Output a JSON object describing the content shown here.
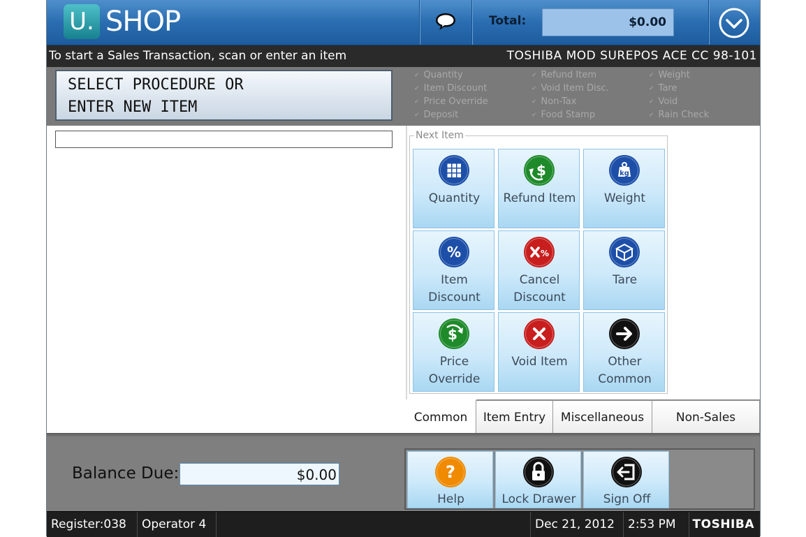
{
  "header": {
    "logo_mark": "U.",
    "logo_text": "SHOP",
    "total_label": "Total:",
    "total_value": "$0.00"
  },
  "status": {
    "message": "To start a Sales Transaction, scan or enter an item",
    "device": "TOSHIBA MOD SUREPOS ACE CC 98-101"
  },
  "prompt": {
    "line1": "SELECT PROCEDURE OR",
    "line2": "ENTER NEW ITEM"
  },
  "procedures": [
    [
      "Quantity",
      "Item Discount",
      "Price Override",
      "Deposit"
    ],
    [
      "Refund Item",
      "Void Item Disc.",
      "Non-Tax",
      "Food Stamp"
    ],
    [
      "Weight",
      "Tare",
      "Void",
      "Rain Check"
    ]
  ],
  "item_entry": {
    "value": ""
  },
  "next_item": {
    "legend": "Next Item",
    "buttons": [
      {
        "lines": [
          "Quantity"
        ],
        "icon": "grid-icon",
        "color": "#1d4fa8"
      },
      {
        "lines": [
          "Refund Item"
        ],
        "icon": "refund-dollar-icon",
        "color": "#1e8a2a"
      },
      {
        "lines": [
          "Weight"
        ],
        "icon": "weight-kg-icon",
        "color": "#1d4fa8"
      },
      {
        "lines": [
          "Item",
          "Discount"
        ],
        "icon": "percent-icon",
        "color": "#1d4fa8"
      },
      {
        "lines": [
          "Cancel",
          "Discount"
        ],
        "icon": "cancel-percent-icon",
        "color": "#c81e1e"
      },
      {
        "lines": [
          "Tare"
        ],
        "icon": "box-icon",
        "color": "#1d4fa8"
      },
      {
        "lines": [
          "Price",
          "Override"
        ],
        "icon": "price-override-icon",
        "color": "#1e8a2a"
      },
      {
        "lines": [
          "Void Item"
        ],
        "icon": "x-icon",
        "color": "#c81e1e"
      },
      {
        "lines": [
          "Other",
          "Common"
        ],
        "icon": "arrow-right-icon",
        "color": "#111111"
      }
    ]
  },
  "tabs": [
    "Common",
    "Item Entry",
    "Miscellaneous",
    "Non-Sales"
  ],
  "active_tab": "Common",
  "balance": {
    "label": "Balance Due:",
    "value": "$0.00"
  },
  "actions": [
    {
      "label": "Help",
      "icon": "question-icon",
      "color": "#f08a00"
    },
    {
      "label": "Lock Drawer",
      "icon": "lock-icon",
      "color": "#111111"
    },
    {
      "label": "Sign Off",
      "icon": "sign-off-icon",
      "color": "#111111"
    }
  ],
  "footer": {
    "register": "Register:038",
    "operator": "Operator 4",
    "date": "Dec 21, 2012",
    "time": "2:53 PM",
    "brand": "TOSHIBA"
  }
}
